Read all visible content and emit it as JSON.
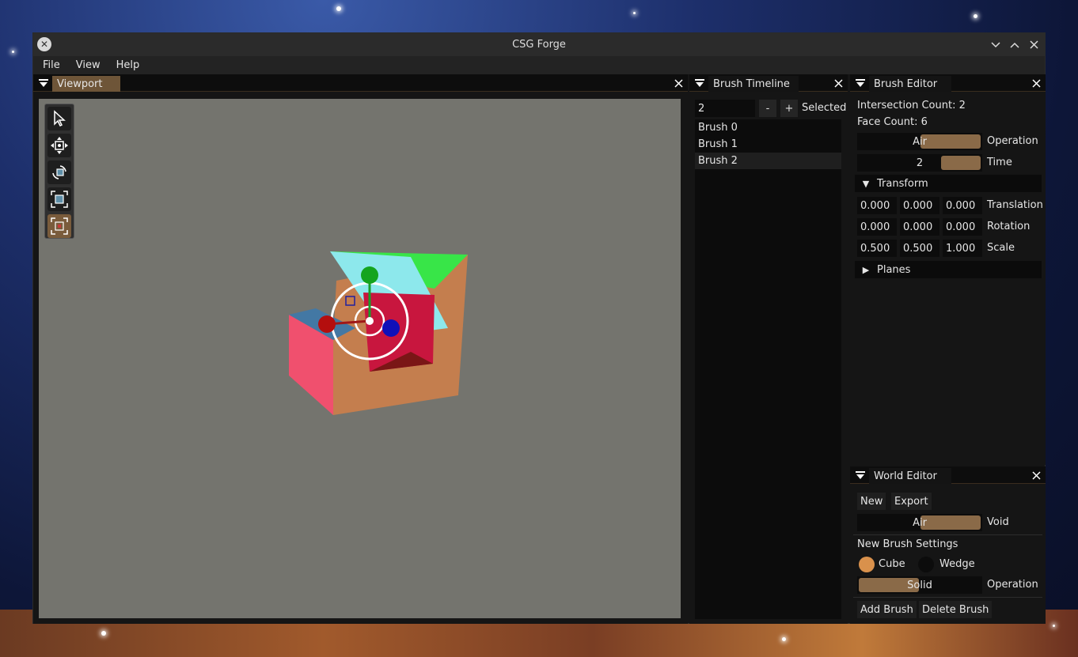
{
  "window": {
    "title": "CSG Forge"
  },
  "menu": {
    "items": [
      "File",
      "View",
      "Help"
    ]
  },
  "viewport": {
    "tab_label": "Viewport",
    "tools": [
      "select-tool-icon",
      "translate-tool-icon",
      "rotate-tool-icon",
      "scale-tool-icon",
      "bounds-tool-icon"
    ],
    "active_tool": "bounds-tool-icon"
  },
  "timeline": {
    "tab_label": "Brush Timeline",
    "selected_value": "2",
    "minus_label": "-",
    "plus_label": "+",
    "selected_label": "Selected",
    "brushes": [
      "Brush 0",
      "Brush 1",
      "Brush 2"
    ],
    "selected_index": 2
  },
  "brush_editor": {
    "tab_label": "Brush Editor",
    "intersection_count": "Intersection Count: 2",
    "face_count": "Face Count: 6",
    "operation_value": "Air",
    "operation_label": "Operation",
    "time_value": "2",
    "time_label": "Time",
    "transform_label": "Transform",
    "translation": [
      "0.000",
      "0.000",
      "0.000"
    ],
    "translation_label": "Translation",
    "rotation": [
      "0.000",
      "0.000",
      "0.000"
    ],
    "rotation_label": "Rotation",
    "scale": [
      "0.500",
      "0.500",
      "1.000"
    ],
    "scale_label": "Scale",
    "planes_label": "Planes"
  },
  "world_editor": {
    "tab_label": "World Editor",
    "new_label": "New",
    "export_label": "Export",
    "void_value": "Air",
    "void_label": "Void",
    "new_brush_settings_label": "New Brush Settings",
    "cube_label": "Cube",
    "wedge_label": "Wedge",
    "selected_shape": "Cube",
    "operation_value": "Solid",
    "operation_label": "Operation",
    "add_brush_label": "Add Brush",
    "delete_brush_label": "Delete Brush"
  },
  "colors": {
    "accent": "#8a6a48",
    "accent_tab": "#6e5538",
    "viewport_bg": "#74746e",
    "radio_on": "#d9914c"
  }
}
